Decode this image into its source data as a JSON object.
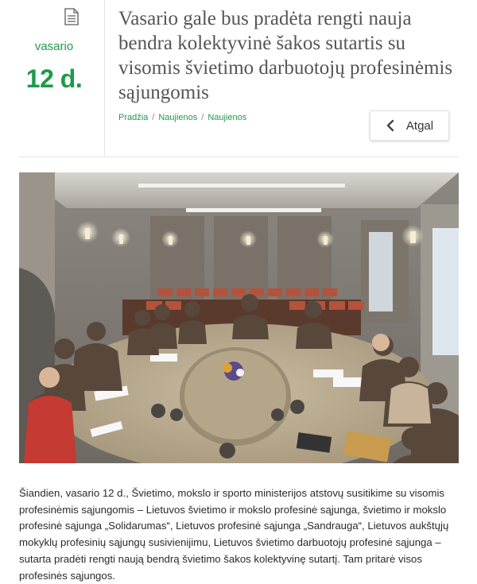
{
  "date": {
    "icon": "document-icon",
    "month": "vasario",
    "day": "12 d."
  },
  "title": "Vasario gale bus pradėta rengti nauja bendra kolektyvinė šakos sutartis su visomis švietimo darbuotojų profesinėmis sąjungomis",
  "breadcrumb": {
    "items": [
      "Pradžia",
      "Naujienos",
      "Naujienos"
    ],
    "separator": "/"
  },
  "back_button": {
    "label": "Atgal",
    "icon": "chevron-left-icon"
  },
  "photo": {
    "kind": "meeting-room-photo"
  },
  "body": "Šiandien, vasario 12 d., Švietimo, mokslo ir sporto ministerijos atstovų susitikime su visomis profesinėmis sąjungomis – Lietuvos švietimo ir mokslo profesinė sąjunga, švietimo ir mokslo profesinė sąjunga „Solidarumas“, Lietuvos profesinė sąjunga „Sandrauga“, Lietuvos aukštųjų mokyklų profesinių sąjungų susivienijimu, Lietuvos švietimo darbuotojų profesinė sąjunga – sutarta pradėti rengti naują bendrą švietimo šakos kolektyvinę sutartį. Tam pritarė visos profesinės sąjungos.",
  "colors": {
    "accent": "#1f9a4a",
    "title": "#555555",
    "text": "#2a2a2a",
    "divider": "#e3e3e3"
  }
}
